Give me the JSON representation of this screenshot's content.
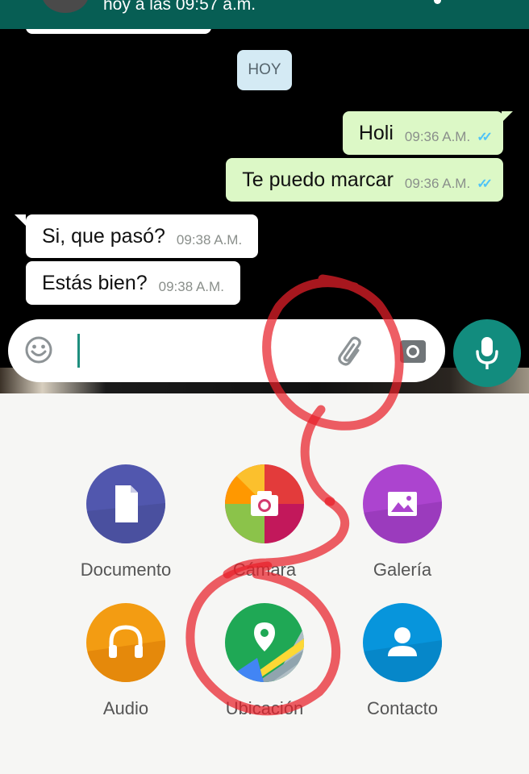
{
  "header": {
    "status": "hoy a las 09:57 a.m."
  },
  "chat": {
    "date_chip": "HOY",
    "messages": [
      {
        "direction": "out",
        "text": "Holi",
        "time": "09:36 A.M.",
        "ticks": "✓✓"
      },
      {
        "direction": "out",
        "text": "Te puedo marcar",
        "time": "09:36 A.M.",
        "ticks": "✓✓"
      },
      {
        "direction": "in",
        "text": "Si, que pasó?",
        "time": "09:38 A.M."
      },
      {
        "direction": "in",
        "text": "Estás bien?",
        "time": "09:38 A.M."
      }
    ]
  },
  "input": {
    "value": "",
    "icons": [
      "emoji-icon",
      "paperclip-icon",
      "camera-icon"
    ]
  },
  "mic_button": {
    "icon": "microphone-icon"
  },
  "attach": {
    "items": [
      {
        "label": "Documento",
        "icon": "document-icon",
        "color": "#5157ae"
      },
      {
        "label": "Cámara",
        "icon": "camera-icon",
        "color": "#d3396d"
      },
      {
        "label": "Galería",
        "icon": "gallery-icon",
        "color": "#ac44cf"
      },
      {
        "label": "Audio",
        "icon": "headphones-icon",
        "color": "#f39c12"
      },
      {
        "label": "Ubicación",
        "icon": "location-pin-icon",
        "color": "#1fa855"
      },
      {
        "label": "Contacto",
        "icon": "contact-person-icon",
        "color": "#0795dc"
      }
    ]
  },
  "colors": {
    "header": "#075e54",
    "outgoing_bubble": "#dcf8c6",
    "incoming_bubble": "#ffffff",
    "accent": "#128c7e",
    "annotation": "#e8202a"
  }
}
